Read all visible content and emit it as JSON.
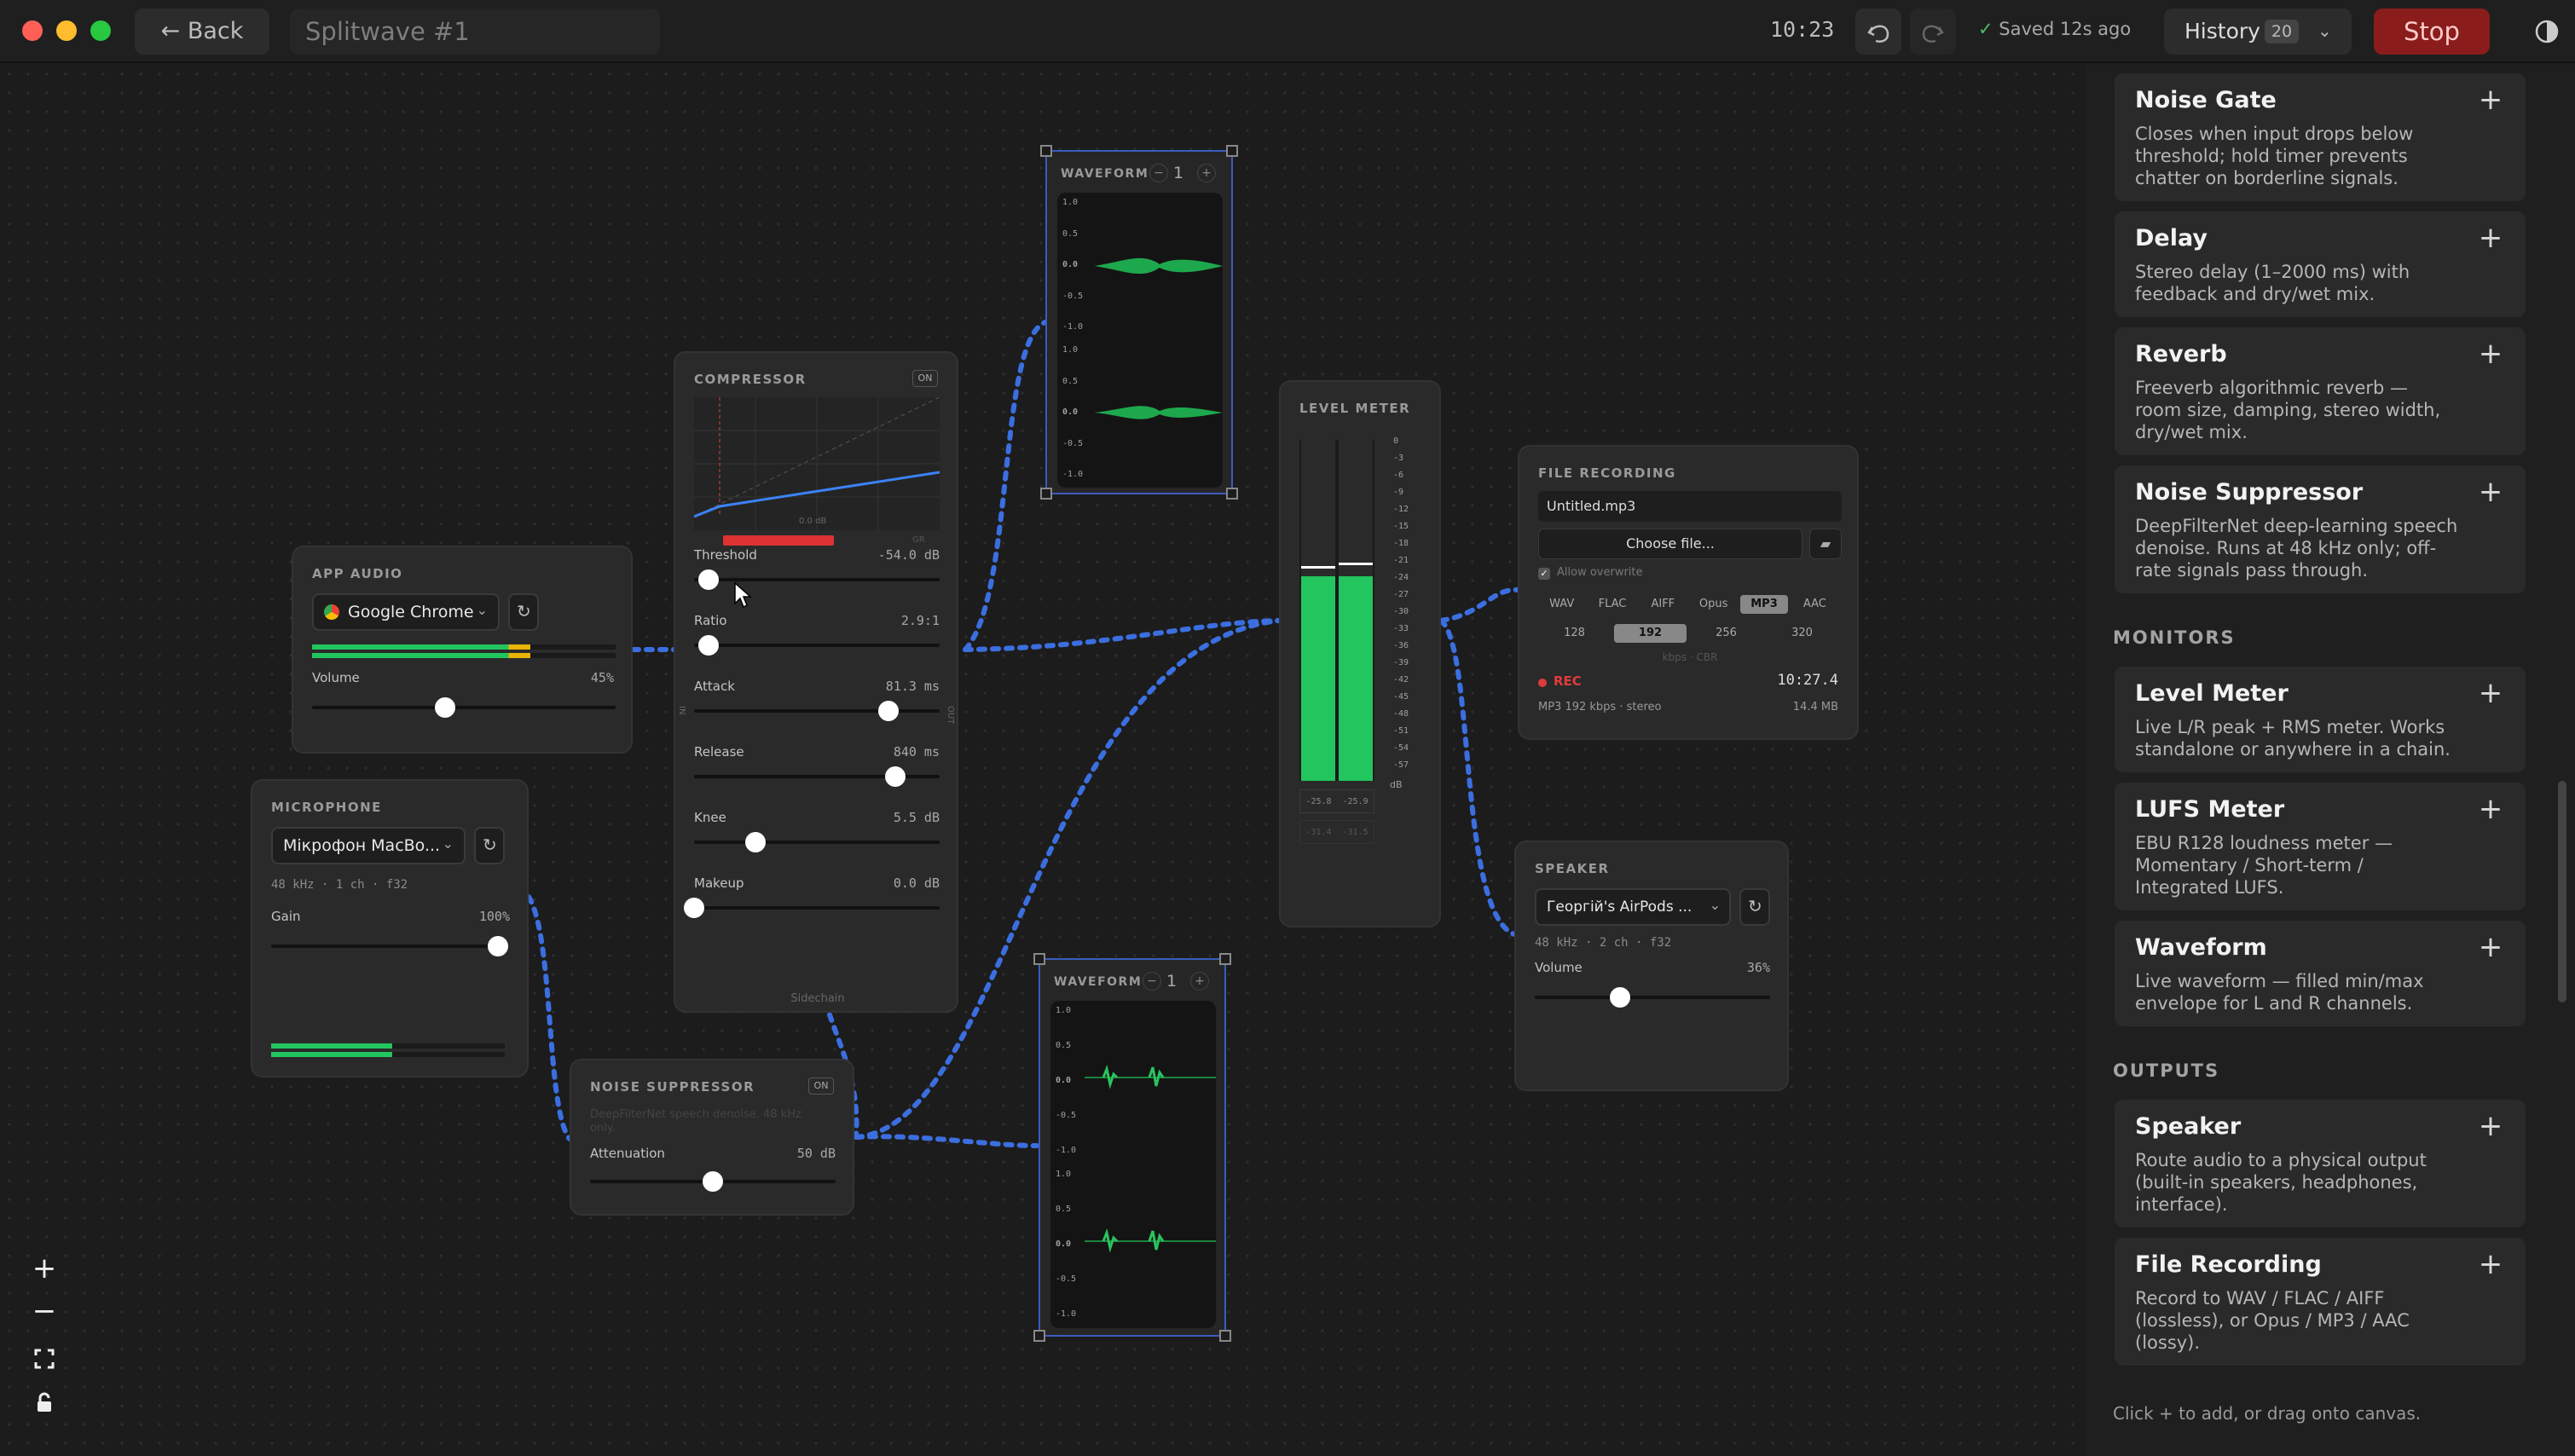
{
  "window": {
    "traffic_lights": [
      "#ff5f57",
      "#febc2e",
      "#28c840"
    ]
  },
  "toolbar": {
    "back_label": "← Back",
    "title": "Splitwave #1",
    "timer": "10:23",
    "saved_text": "Saved 12s ago",
    "history_label": "History",
    "history_count": "20",
    "stop_label": "Stop",
    "undo_icon": "undo-icon",
    "redo_icon": "redo-icon",
    "theme_icon": "contrast-icon",
    "accent": "#8a1c1c"
  },
  "nodes": {
    "app_audio": {
      "title": "APP AUDIO",
      "source": "Google Chrome",
      "volume_label": "Volume",
      "volume_value": "45%",
      "volume_level": 0.45,
      "meter_level": 0.72
    },
    "microphone": {
      "title": "MICROPHONE",
      "device": "Мікрофон MacBo...",
      "format": "48 kHz · 1 ch · f32",
      "gain_label": "Gain",
      "gain_value": "100%",
      "gain_level": 1.0
    },
    "compressor": {
      "title": "COMPRESSOR",
      "toggle": "ON",
      "graph_label": "0.0 dB",
      "gr_label": "GR",
      "params": [
        {
          "label": "Threshold",
          "value": "-54.0 dB",
          "level": 0.06
        },
        {
          "label": "Ratio",
          "value": "2.9:1",
          "level": 0.06
        },
        {
          "label": "Attack",
          "value": "81.3 ms",
          "level": 0.79
        },
        {
          "label": "Release",
          "value": "840 ms",
          "level": 0.82
        },
        {
          "label": "Knee",
          "value": "5.5 dB",
          "level": 0.25
        },
        {
          "label": "Makeup",
          "value": "0.0 dB",
          "level": 0.0
        }
      ],
      "sidechain_label": "Sidechain",
      "in_label": "IN",
      "out_label": "OUT"
    },
    "noise_suppressor": {
      "title": "NOISE SUPPRESSOR",
      "toggle": "ON",
      "desc": "DeepFilterNet speech denoise. 48 kHz only.",
      "atten_label": "Attenuation",
      "atten_value": "50 dB",
      "atten_level": 0.5
    },
    "waveform_top": {
      "title": "WAVEFORM",
      "channels": "1",
      "axis": [
        "1.0",
        "0.5",
        "0.0",
        "-0.5",
        "-1.0",
        "1.0",
        "0.5",
        "0.0",
        "-0.5",
        "-1.0"
      ]
    },
    "waveform_bottom": {
      "title": "WAVEFORM",
      "channels": "1",
      "axis": [
        "1.0",
        "0.5",
        "0.0",
        "-0.5",
        "-1.0",
        "1.0",
        "0.5",
        "0.0",
        "-0.5",
        "-1.0"
      ]
    },
    "level_meter": {
      "title": "LEVEL METER",
      "scale": [
        "0",
        "-3",
        "-6",
        "-9",
        "-12",
        "-15",
        "-18",
        "-21",
        "-24",
        "-27",
        "-30",
        "-33",
        "-36",
        "-39",
        "-42",
        "-45",
        "-48",
        "-51",
        "-54",
        "-57"
      ],
      "unit": "dB",
      "peak_l": "-25.8",
      "peak_r": "-25.9",
      "rms_l": "-31.4",
      "rms_r": "-31.5",
      "level": 0.6
    },
    "file_recording": {
      "title": "FILE RECORDING",
      "filename": "Untitled.mp3",
      "choose_label": "Choose file...",
      "allow_overwrite": "Allow overwrite",
      "formats": [
        "WAV",
        "FLAC",
        "AIFF",
        "Opus",
        "MP3",
        "AAC"
      ],
      "selected_format": "MP3",
      "bitrates": [
        "128",
        "192",
        "256",
        "320"
      ],
      "selected_bitrate": "192",
      "bitrate_hint": "kbps · CBR",
      "rec_label": "REC",
      "rec_time": "10:27.4",
      "summary": "MP3 192 kbps · stereo",
      "size": "14.4 MB"
    },
    "speaker": {
      "title": "SPEAKER",
      "device": "Георгій's AirPods ...",
      "format": "48 kHz · 2 ch · f32",
      "volume_label": "Volume",
      "volume_value": "36%",
      "volume_level": 0.36
    }
  },
  "sidebar": {
    "processors": [
      {
        "title": "Noise Gate",
        "desc": "Closes when input drops below threshold; hold timer prevents chatter on borderline signals."
      },
      {
        "title": "Delay",
        "desc": "Stereo delay (1–2000 ms) with feedback and dry/wet mix."
      },
      {
        "title": "Reverb",
        "desc": "Freeverb algorithmic reverb — room size, damping, stereo width, dry/wet mix."
      },
      {
        "title": "Noise Suppressor",
        "desc": "DeepFilterNet deep-learning speech denoise. Runs at 48 kHz only; off-rate signals pass through."
      }
    ],
    "monitors_heading": "MONITORS",
    "monitors": [
      {
        "title": "Level Meter",
        "desc": "Live L/R peak + RMS meter. Works standalone or anywhere in a chain."
      },
      {
        "title": "LUFS Meter",
        "desc": "EBU R128 loudness meter — Momentary / Short-term / Integrated LUFS."
      },
      {
        "title": "Waveform",
        "desc": "Live waveform — filled min/max envelope for L and R channels."
      }
    ],
    "outputs_heading": "OUTPUTS",
    "outputs": [
      {
        "title": "Speaker",
        "desc": "Route audio to a physical output (built-in speakers, headphones, interface)."
      },
      {
        "title": "File Recording",
        "desc": "Record to WAV / FLAC / AIFF (lossless), or Opus / MP3 / AAC (lossy)."
      }
    ],
    "footer": "Click + to add, or drag onto canvas.",
    "add_symbol": "+"
  },
  "zoom_controls": [
    "+",
    "−",
    "⛶",
    "🔓"
  ],
  "colors": {
    "wire": "#3b6fe0",
    "meter_green": "#22c55e",
    "waveform_green": "#1ea84d",
    "rec_red": "#e03b3b"
  }
}
